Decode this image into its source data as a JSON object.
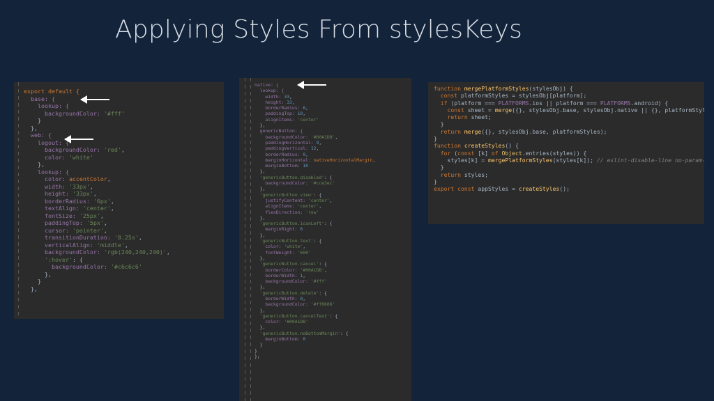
{
  "slide": {
    "title": "Applying Styles From stylesKeys"
  },
  "panels": [
    {
      "name": "export-default-code",
      "lines": [
        [
          [
            "export default {",
            "kw"
          ]
        ],
        [
          [
            "  base: {",
            "key"
          ]
        ],
        [
          [
            "    lookup: {",
            "key"
          ]
        ],
        [
          [
            "      backgroundColor: ",
            "key"
          ],
          [
            "'#fff'",
            "str"
          ]
        ],
        [
          [
            "    }",
            "t"
          ]
        ],
        [
          [
            "  },",
            "t"
          ]
        ],
        [
          [
            "  web: {",
            "key"
          ]
        ],
        [
          [
            "    logout: {",
            "key"
          ]
        ],
        [
          [
            "      backgroundColor: ",
            "key"
          ],
          [
            "'red'",
            "str"
          ],
          [
            ",",
            "t"
          ]
        ],
        [
          [
            "      color: ",
            "key"
          ],
          [
            "'white'",
            "str"
          ]
        ],
        [
          [
            "    },",
            "t"
          ]
        ],
        [
          [
            "    lookup: {",
            "key"
          ]
        ],
        [
          [
            "      color: ",
            "key"
          ],
          [
            "accentColor",
            "kw"
          ],
          [
            ",",
            "t"
          ]
        ],
        [
          [
            "      width: ",
            "key"
          ],
          [
            "'33px'",
            "str"
          ],
          [
            ",",
            "t"
          ]
        ],
        [
          [
            "      height: ",
            "key"
          ],
          [
            "'33px'",
            "str"
          ],
          [
            ",",
            "t"
          ]
        ],
        [
          [
            "      borderRadius: ",
            "key"
          ],
          [
            "'6px'",
            "str"
          ],
          [
            ",",
            "t"
          ]
        ],
        [
          [
            "      textAlign: ",
            "key"
          ],
          [
            "'center'",
            "str"
          ],
          [
            ",",
            "t"
          ]
        ],
        [
          [
            "      fontSize: ",
            "key"
          ],
          [
            "'25px'",
            "str"
          ],
          [
            ",",
            "t"
          ]
        ],
        [
          [
            "      paddingTop: ",
            "key"
          ],
          [
            "'5px'",
            "str"
          ],
          [
            ",",
            "t"
          ]
        ],
        [
          [
            "      cursor: ",
            "key"
          ],
          [
            "'pointer'",
            "str"
          ],
          [
            ",",
            "t"
          ]
        ],
        [
          [
            "      transitionDuration: ",
            "key"
          ],
          [
            "'0.25s'",
            "str"
          ],
          [
            ",",
            "t"
          ]
        ],
        [
          [
            "      verticalAlign: ",
            "key"
          ],
          [
            "'middle'",
            "str"
          ],
          [
            ",",
            "t"
          ]
        ],
        [
          [
            "      backgroundColor: ",
            "key"
          ],
          [
            "'rgb(240,240,240)'",
            "str"
          ],
          [
            ",",
            "t"
          ]
        ],
        [
          [
            "      ':hover'",
            "str"
          ],
          [
            ": {",
            "t"
          ]
        ],
        [
          [
            "        backgroundColor: ",
            "key"
          ],
          [
            "'#c6c6c6'",
            "str"
          ]
        ],
        [
          [
            "      },",
            "t"
          ]
        ],
        [
          [
            "    }",
            "t"
          ]
        ],
        [
          [
            "  },",
            "t"
          ]
        ]
      ]
    },
    {
      "name": "native-styles-code",
      "lines": [
        [
          [
            "native: {",
            "key"
          ]
        ],
        [
          [
            "  lookup: {",
            "key"
          ]
        ],
        [
          [
            "    width: ",
            "key"
          ],
          [
            "33",
            "num"
          ],
          [
            ",",
            "t"
          ]
        ],
        [
          [
            "    height: ",
            "key"
          ],
          [
            "33",
            "num"
          ],
          [
            ",",
            "t"
          ]
        ],
        [
          [
            "    borderRadius: ",
            "key"
          ],
          [
            "6",
            "num"
          ],
          [
            ",",
            "t"
          ]
        ],
        [
          [
            "    paddingTop: ",
            "key"
          ],
          [
            "10",
            "num"
          ],
          [
            ",",
            "t"
          ]
        ],
        [
          [
            "    alignItems: ",
            "key"
          ],
          [
            "'center'",
            "str"
          ]
        ],
        [
          [
            "  },",
            "t"
          ]
        ],
        [
          [
            "  genericButton: {",
            "key"
          ]
        ],
        [
          [
            "    backgroundColor: ",
            "key"
          ],
          [
            "'#00A1DB'",
            "str"
          ],
          [
            ",",
            "t"
          ]
        ],
        [
          [
            "    paddingHorizontal: ",
            "key"
          ],
          [
            "9",
            "num"
          ],
          [
            ",",
            "t"
          ]
        ],
        [
          [
            "    paddingVertical: ",
            "key"
          ],
          [
            "12",
            "num"
          ],
          [
            ",",
            "t"
          ]
        ],
        [
          [
            "    borderRadius: ",
            "key"
          ],
          [
            "0",
            "num"
          ],
          [
            ",",
            "t"
          ]
        ],
        [
          [
            "    marginHorizontal: ",
            "key"
          ],
          [
            "nativeHorizontalMargin",
            "kw"
          ],
          [
            ",",
            "t"
          ]
        ],
        [
          [
            "    marginBottom: ",
            "key"
          ],
          [
            "10",
            "num"
          ]
        ],
        [
          [
            "  },",
            "t"
          ]
        ],
        [
          [
            "  'genericButton.disabled'",
            "str"
          ],
          [
            ": {",
            "t"
          ]
        ],
        [
          [
            "    backgroundColor: ",
            "key"
          ],
          [
            "'#cce3ec'",
            "str"
          ]
        ],
        [
          [
            "  },",
            "t"
          ]
        ],
        [
          [
            "  'genericButton.view'",
            "str"
          ],
          [
            ": {",
            "t"
          ]
        ],
        [
          [
            "    justifyContent: ",
            "key"
          ],
          [
            "'center'",
            "str"
          ],
          [
            ",",
            "t"
          ]
        ],
        [
          [
            "    alignItems: ",
            "key"
          ],
          [
            "'center'",
            "str"
          ],
          [
            ",",
            "t"
          ]
        ],
        [
          [
            "    flexDirection: ",
            "key"
          ],
          [
            "'row'",
            "str"
          ]
        ],
        [
          [
            "  },",
            "t"
          ]
        ],
        [
          [
            "  'genericButton.iconLeft'",
            "str"
          ],
          [
            ": {",
            "t"
          ]
        ],
        [
          [
            "    marginRight: ",
            "key"
          ],
          [
            "6",
            "num"
          ]
        ],
        [
          [
            "  },",
            "t"
          ]
        ],
        [
          [
            "  'genericButton.text'",
            "str"
          ],
          [
            ": {",
            "t"
          ]
        ],
        [
          [
            "    color: ",
            "key"
          ],
          [
            "'white'",
            "str"
          ],
          [
            ",",
            "t"
          ]
        ],
        [
          [
            "    fontWeight: ",
            "key"
          ],
          [
            "'600'",
            "str"
          ]
        ],
        [
          [
            "  },",
            "t"
          ]
        ],
        [
          [
            "  'genericButton.cancel'",
            "str"
          ],
          [
            ": {",
            "t"
          ]
        ],
        [
          [
            "    borderColor: ",
            "key"
          ],
          [
            "'#00A1DB'",
            "str"
          ],
          [
            ",",
            "t"
          ]
        ],
        [
          [
            "    borderWidth: ",
            "key"
          ],
          [
            "1",
            "num"
          ],
          [
            ",",
            "t"
          ]
        ],
        [
          [
            "    backgroundColor: ",
            "key"
          ],
          [
            "'#fff'",
            "str"
          ]
        ],
        [
          [
            "  },",
            "t"
          ]
        ],
        [
          [
            "  'genericButton.delete'",
            "str"
          ],
          [
            ": {",
            "t"
          ]
        ],
        [
          [
            "    borderWidth: ",
            "key"
          ],
          [
            "0",
            "num"
          ],
          [
            ",",
            "t"
          ]
        ],
        [
          [
            "    backgroundColor: ",
            "key"
          ],
          [
            "'#ff0606'",
            "str"
          ]
        ],
        [
          [
            "  },",
            "t"
          ]
        ],
        [
          [
            "  'genericButton.cancelText'",
            "str"
          ],
          [
            ": {",
            "t"
          ]
        ],
        [
          [
            "    color: ",
            "key"
          ],
          [
            "'#00A1DB'",
            "str"
          ]
        ],
        [
          [
            "  },",
            "t"
          ]
        ],
        [
          [
            "  'genericButton.noBottomMargin'",
            "str"
          ],
          [
            ": {",
            "t"
          ]
        ],
        [
          [
            "    marginBottom: ",
            "key"
          ],
          [
            "0",
            "num"
          ]
        ],
        [
          [
            "  }",
            "t"
          ]
        ],
        [
          [
            "}",
            "t"
          ]
        ],
        [
          [
            "};",
            "t"
          ]
        ]
      ]
    },
    {
      "name": "merge-functions-code",
      "lines": [
        [
          [
            "function ",
            "kw"
          ],
          [
            "mergePlatformStyles",
            "fn"
          ],
          [
            "(stylesObj) {",
            "t"
          ]
        ],
        [
          [
            "  const ",
            "kw"
          ],
          [
            "platformStyles = stylesObj[platform];",
            "t"
          ]
        ],
        [
          [
            "  if ",
            "kw"
          ],
          [
            "(platform === ",
            "t"
          ],
          [
            "PLATFORMS",
            "key"
          ],
          [
            ".ios || platform === ",
            "t"
          ],
          [
            "PLATFORMS",
            "key"
          ],
          [
            ".android) {",
            "t"
          ]
        ],
        [
          [
            "    const ",
            "kw"
          ],
          [
            "sheet = ",
            "t"
          ],
          [
            "merge",
            "fn"
          ],
          [
            "({}, stylesObj.base, stylesObj.native || {}, platformStyles);",
            "t"
          ]
        ],
        [
          [
            "    return ",
            "kw"
          ],
          [
            "sheet;",
            "t"
          ]
        ],
        [
          [
            "  }",
            "t"
          ]
        ],
        [
          [
            "  return ",
            "kw"
          ],
          [
            "merge",
            "fn"
          ],
          [
            "({}, stylesObj.base, platformStyles);",
            "t"
          ]
        ],
        [
          [
            "}",
            "t"
          ]
        ],
        [
          [
            "",
            "t"
          ]
        ],
        [
          [
            "function ",
            "kw"
          ],
          [
            "createStyles",
            "fn"
          ],
          [
            "() {",
            "t"
          ]
        ],
        [
          [
            "  for ",
            "kw"
          ],
          [
            "(",
            "t"
          ],
          [
            "const ",
            "kw"
          ],
          [
            "[k] ",
            "t"
          ],
          [
            "of ",
            "kw"
          ],
          [
            "Object",
            "var"
          ],
          [
            ".entries(styles)) {",
            "t"
          ]
        ],
        [
          [
            "    styles[k] = ",
            "t"
          ],
          [
            "mergePlatformStyles",
            "fn"
          ],
          [
            "(styles[k]); ",
            "t"
          ],
          [
            "// eslint-disable-line no-param-reassign",
            "cmt"
          ]
        ],
        [
          [
            "  }",
            "t"
          ]
        ],
        [
          [
            "  return ",
            "kw"
          ],
          [
            "styles;",
            "t"
          ]
        ],
        [
          [
            "}",
            "t"
          ]
        ],
        [
          [
            "",
            "t"
          ]
        ],
        [
          [
            "export const ",
            "kw"
          ],
          [
            "appStyles = ",
            "t"
          ],
          [
            "createStyles",
            "fn"
          ],
          [
            "();",
            "t"
          ]
        ]
      ]
    }
  ],
  "colors": {
    "background": "#12233a",
    "title": "#d8dde6",
    "editor_bg": "#2b2b2b",
    "keyword": "#cc7832",
    "property": "#9876aa",
    "string": "#6a8759",
    "number": "#6897bb",
    "function": "#ffc66d",
    "comment": "#808080",
    "arrow": "#ffffff"
  },
  "icons": [
    "arrow-left-icon"
  ]
}
